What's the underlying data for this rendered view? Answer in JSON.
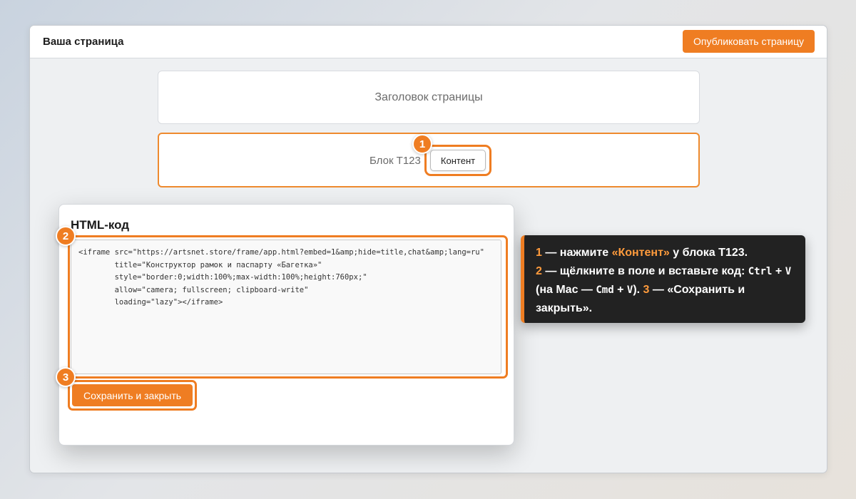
{
  "header": {
    "page_title": "Ваша страница",
    "publish_label": "Опубликовать страницу"
  },
  "blocks": {
    "header_block_label": "Заголовок страницы",
    "t123_label": "Блок T123",
    "content_button_label": "Контент"
  },
  "modal": {
    "title": "HTML-код",
    "code_value": "<iframe src=\"https://artsnet.store/frame/app.html?embed=1&amp;hide=title,chat&amp;lang=ru\"\n        title=\"Конструктор рамок и паспарту «Багетка»\"\n        style=\"border:0;width:100%;max-width:100%;height:760px;\"\n        allow=\"camera; fullscreen; clipboard-write\"\n        loading=\"lazy\"></iframe>",
    "save_label": "Сохранить и закрыть"
  },
  "steps": {
    "step1": "1",
    "step2": "2",
    "step3": "3"
  },
  "tooltip": {
    "s1_num": "1",
    "s1_a": " — нажмите ",
    "s1_hl": "«Контент»",
    "s1_b": " у блока T123.",
    "s2_num": "2",
    "s2_a": " — щёлкните в поле и вставьте код: ",
    "key_ctrl": "Ctrl",
    "plus1": " + ",
    "key_v1": "V",
    "mac_a": " (на Mac — ",
    "key_cmd": "Cmd",
    "plus2": " + ",
    "key_v2": "V",
    "mac_b": "). ",
    "s3_num": "3",
    "s3_a": " — «Сохранить и закрыть»."
  },
  "colors": {
    "accent": "#ef7d22",
    "tooltip_bg": "#222222",
    "highlight_text": "#ff9b3c"
  }
}
